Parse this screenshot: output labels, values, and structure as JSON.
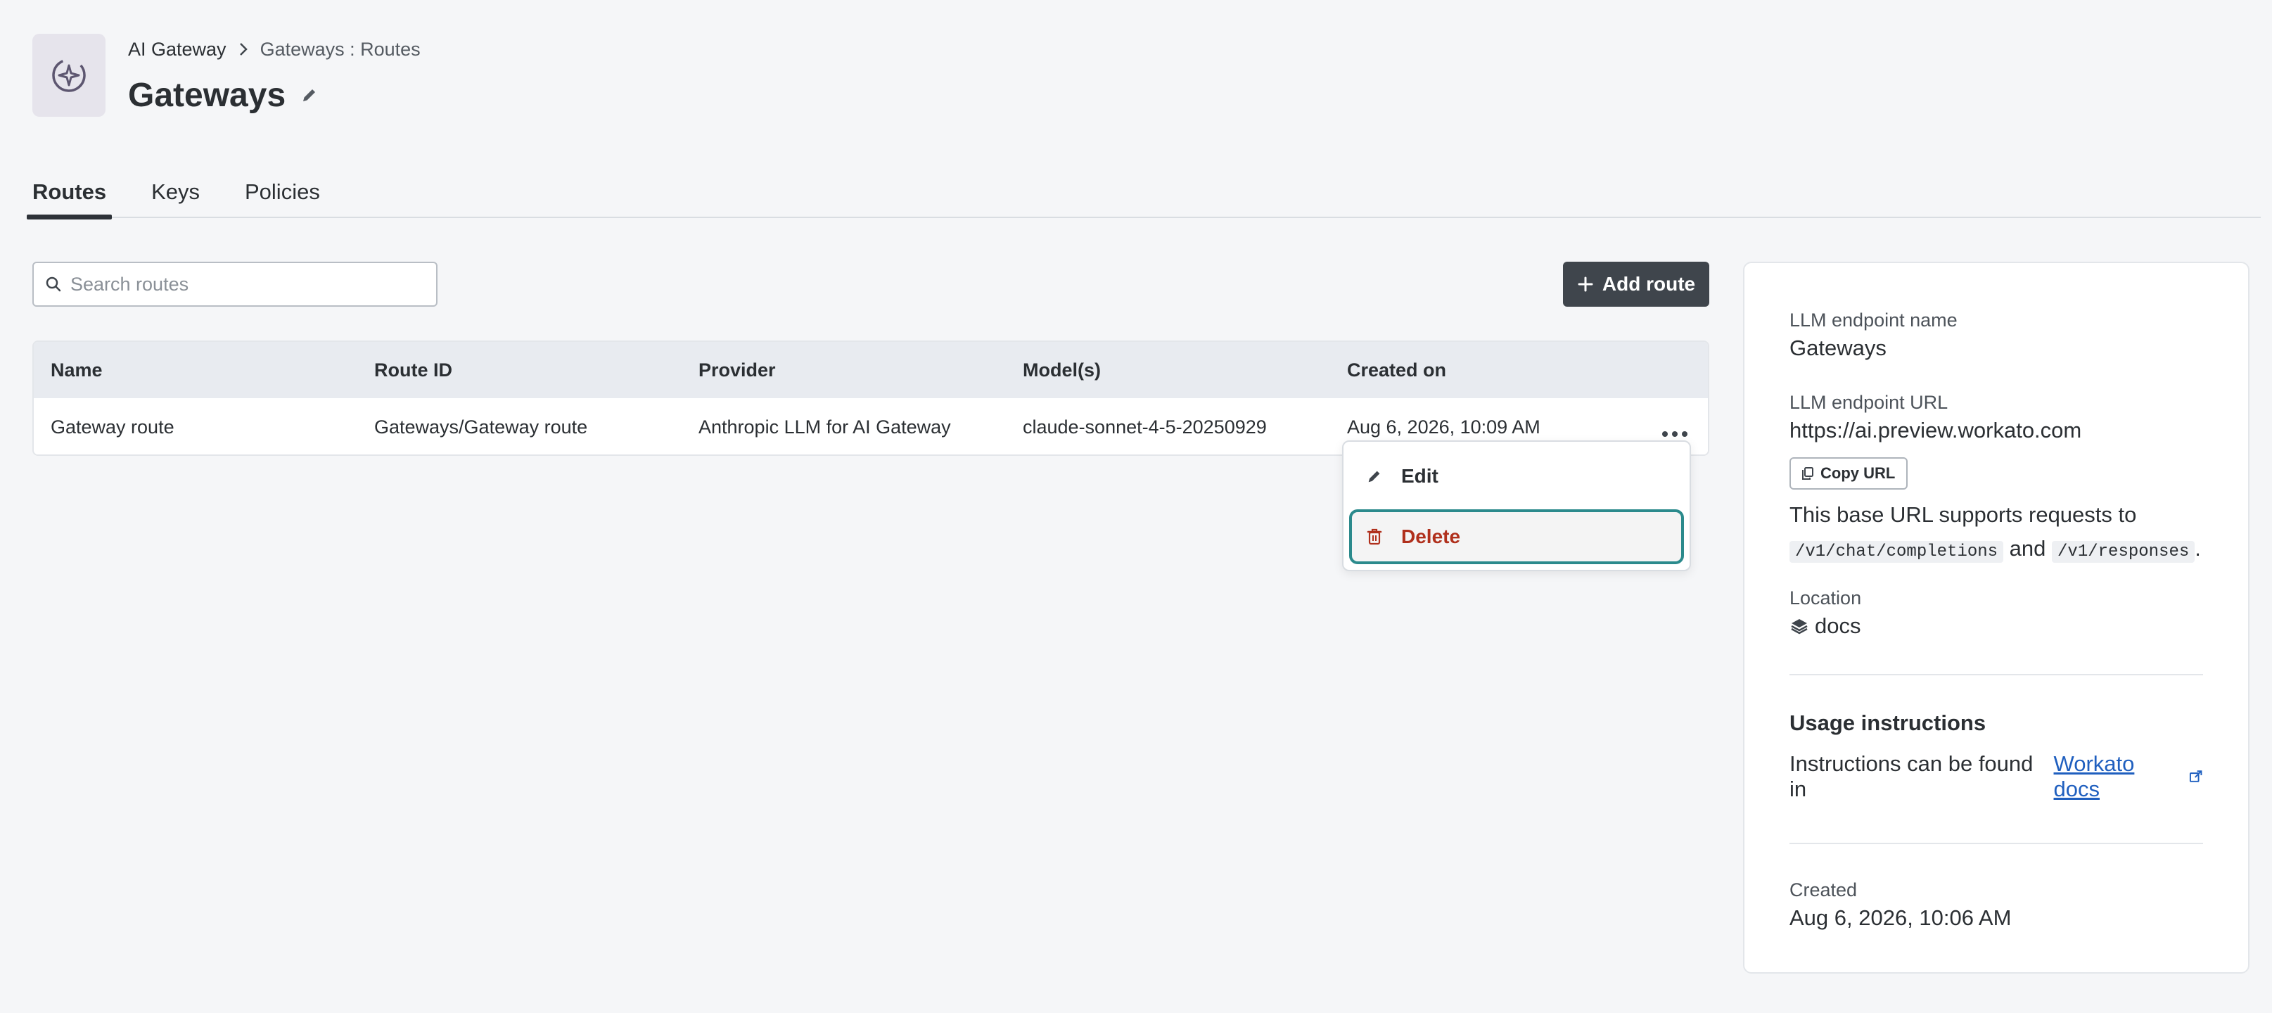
{
  "header": {
    "breadcrumb": {
      "root": "AI Gateway",
      "current": "Gateways : Routes"
    },
    "title": "Gateways"
  },
  "tabs": [
    {
      "label": "Routes",
      "active": true
    },
    {
      "label": "Keys",
      "active": false
    },
    {
      "label": "Policies",
      "active": false
    }
  ],
  "search": {
    "placeholder": "Search routes",
    "value": ""
  },
  "actions": {
    "add_route_label": "Add route"
  },
  "table": {
    "columns": [
      "Name",
      "Route ID",
      "Provider",
      "Model(s)",
      "Created on"
    ],
    "rows": [
      {
        "name": "Gateway route",
        "route_id": "Gateways/Gateway route",
        "provider": "Anthropic LLM for AI Gateway",
        "models": "claude-sonnet-4-5-20250929",
        "created_on": "Aug 6, 2026, 10:09 AM"
      }
    ]
  },
  "row_menu": {
    "edit_label": "Edit",
    "delete_label": "Delete"
  },
  "panel": {
    "endpoint_name_label": "LLM endpoint name",
    "endpoint_name": "Gateways",
    "endpoint_url_label": "LLM endpoint URL",
    "endpoint_url": "https://ai.preview.workato.com",
    "copy_url_label": "Copy URL",
    "support_text_prefix": "This base URL supports requests to",
    "support_path_1": "/v1/chat/completions",
    "support_and": "and",
    "support_path_2": "/v1/responses",
    "support_end": ".",
    "location_label": "Location",
    "location_value": "docs",
    "usage_title": "Usage instructions",
    "instructions_prefix": "Instructions can be found in",
    "docs_link": "Workato docs",
    "created_label": "Created",
    "created_value": "Aug 6, 2026, 10:06 AM"
  },
  "colors": {
    "primary_button": "#3f454c",
    "delete_text": "#b0301c",
    "focus_ring": "#2b8a8c",
    "link": "#1f5fbf"
  }
}
